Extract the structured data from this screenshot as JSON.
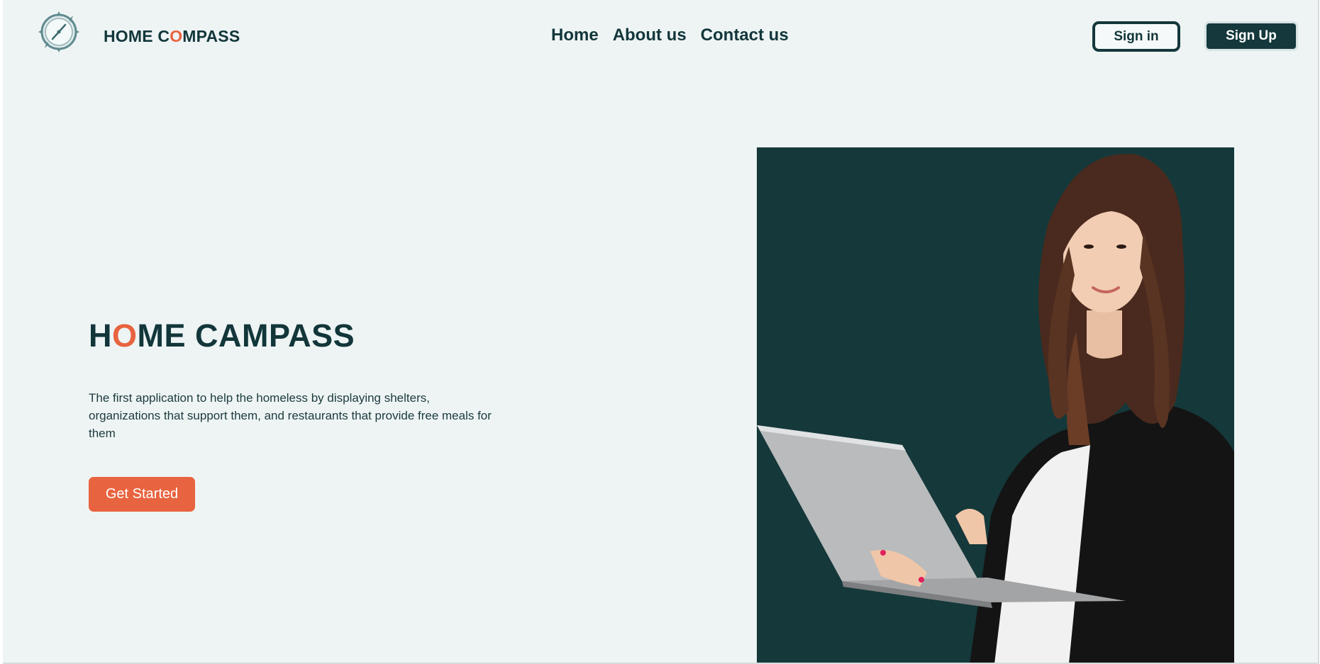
{
  "header": {
    "brand_part1": "HOME C",
    "brand_accent": "O",
    "brand_part2": "MPASS",
    "nav": [
      {
        "label": "Home"
      },
      {
        "label": "About us"
      },
      {
        "label": "Contact us"
      }
    ],
    "signin_label": "Sign in",
    "signup_label": "Sign Up"
  },
  "hero": {
    "title_part1": "H",
    "title_accent": "O",
    "title_part2": "ME CAMPASS",
    "description": "The first application to help the homeless by displaying shelters, organizations that support them, and restaurants that provide free meals for them",
    "cta_label": "Get Started"
  },
  "colors": {
    "background": "#eef4f4",
    "primary": "#14383c",
    "accent": "#e8633f"
  },
  "icons": {
    "logo": "compass-icon"
  }
}
